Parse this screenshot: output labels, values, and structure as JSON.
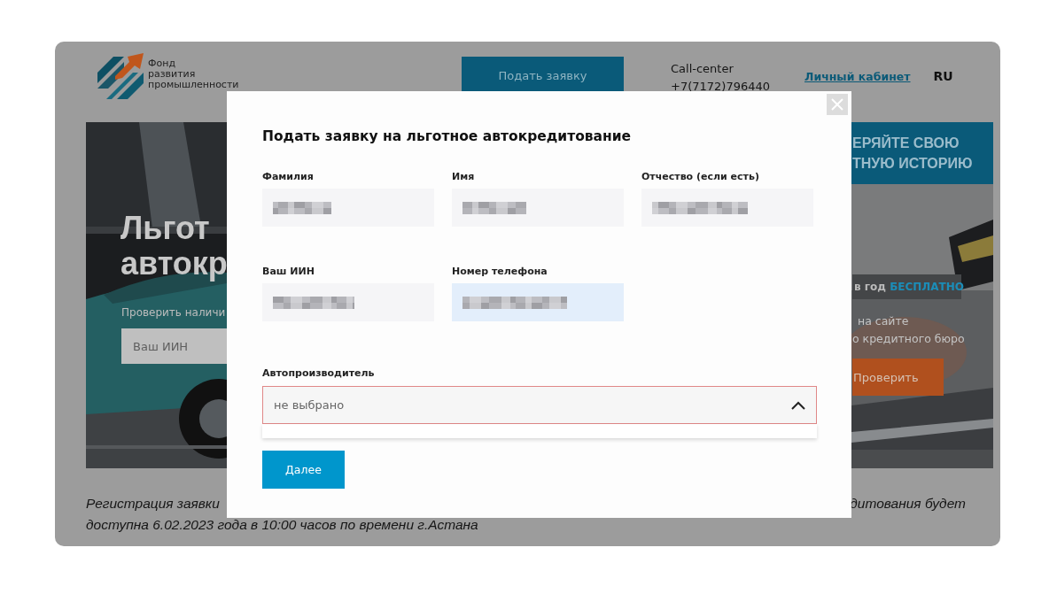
{
  "header": {
    "logo_lines": [
      "Фонд",
      "развития",
      "промышленности"
    ],
    "apply_button": "Подать заявку",
    "call_center": {
      "label": "Call-center",
      "phone": "+7(7172)796440"
    },
    "account_link": "Личный кабинет",
    "language": {
      "label": "RU",
      "selected": true
    }
  },
  "hero": {
    "title_lines": [
      "Льгот",
      "автокр"
    ],
    "check_label": "Проверить наличи",
    "iin_placeholder": "Ваш ИИН"
  },
  "promo": {
    "heading_lines": [
      "ЕРЯЙТЕ СВОЮ",
      "ТНУЮ ИСТОРИЮ"
    ],
    "tag_text": "в год",
    "tag_highlight": "БЕСПЛАТНО",
    "text_lines": [
      "на сайте",
      "о кредитного бюро"
    ],
    "button": "Проверить"
  },
  "notice": {
    "line1_left": "Регистрация заявки",
    "line1_right": "дитования будет",
    "line2": "доступна 6.02.2023 года в 10:00 часов по времени г.Астана"
  },
  "modal": {
    "title": "Подать заявку на льготное автокредитование",
    "fields": [
      {
        "label": "Фамилия",
        "redacted": true,
        "focused": false
      },
      {
        "label": "Имя",
        "redacted": true,
        "focused": false
      },
      {
        "label": "Отчество (если есть)",
        "redacted": true,
        "focused": false
      },
      {
        "label": "Ваш ИИН",
        "redacted": true,
        "focused": false
      },
      {
        "label": "Номер телефона",
        "redacted": true,
        "focused": true
      }
    ],
    "select": {
      "label": "Автопроизводитель",
      "placeholder": "не выбрано",
      "error": true,
      "expanded": true
    },
    "submit": "Далее"
  }
}
